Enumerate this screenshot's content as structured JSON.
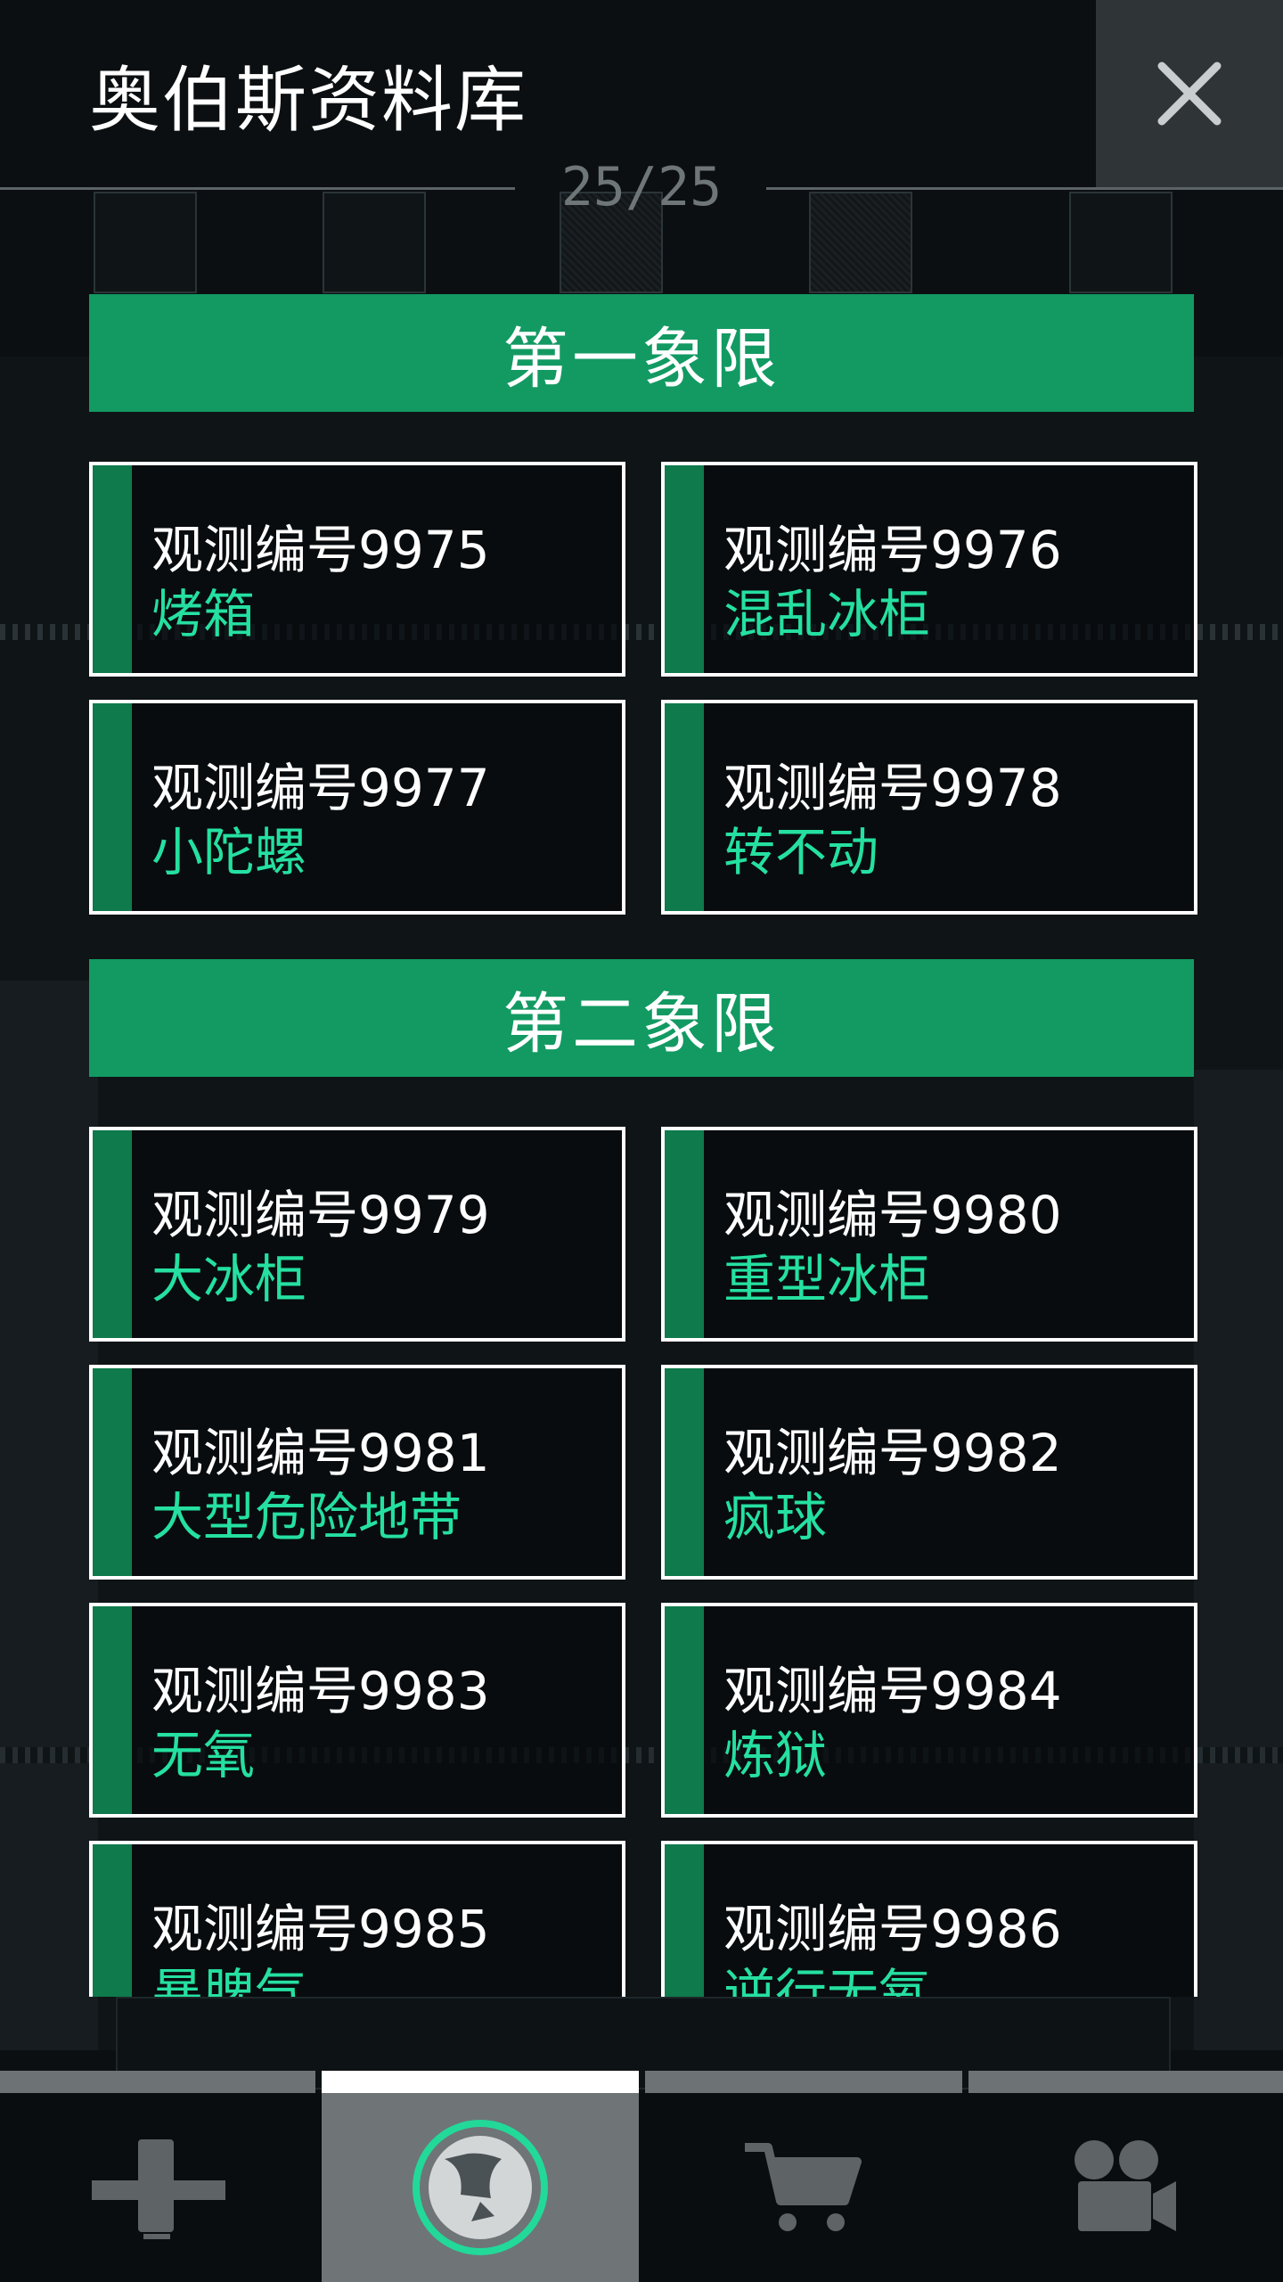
{
  "header": {
    "title": "奥伯斯资料库",
    "page_counter": "25/25",
    "close_icon": "close-icon"
  },
  "sections": [
    {
      "title": "第一象限",
      "cards": [
        {
          "code": "观测编号9975",
          "name": "烤箱"
        },
        {
          "code": "观测编号9976",
          "name": "混乱冰柜"
        },
        {
          "code": "观测编号9977",
          "name": "小陀螺"
        },
        {
          "code": "观测编号9978",
          "name": "转不动"
        }
      ]
    },
    {
      "title": "第二象限",
      "cards": [
        {
          "code": "观测编号9979",
          "name": "大冰柜"
        },
        {
          "code": "观测编号9980",
          "name": "重型冰柜"
        },
        {
          "code": "观测编号9981",
          "name": "大型危险地带"
        },
        {
          "code": "观测编号9982",
          "name": "疯球"
        },
        {
          "code": "观测编号9983",
          "name": "无氧"
        },
        {
          "code": "观测编号9984",
          "name": "炼狱"
        },
        {
          "code": "观测编号9985",
          "name": "暴脾气"
        },
        {
          "code": "观测编号9986",
          "name": "逆行无氧"
        }
      ]
    }
  ],
  "bottom_nav": {
    "active_index": 1,
    "tabs": [
      {
        "icon": "telescope-icon"
      },
      {
        "icon": "planet-icon"
      },
      {
        "icon": "shopping-cart-icon"
      },
      {
        "icon": "video-camera-icon"
      }
    ]
  },
  "colors": {
    "accent_green": "#129a62",
    "name_green": "#25e0a0",
    "stripe_green": "#0f7a4c"
  }
}
